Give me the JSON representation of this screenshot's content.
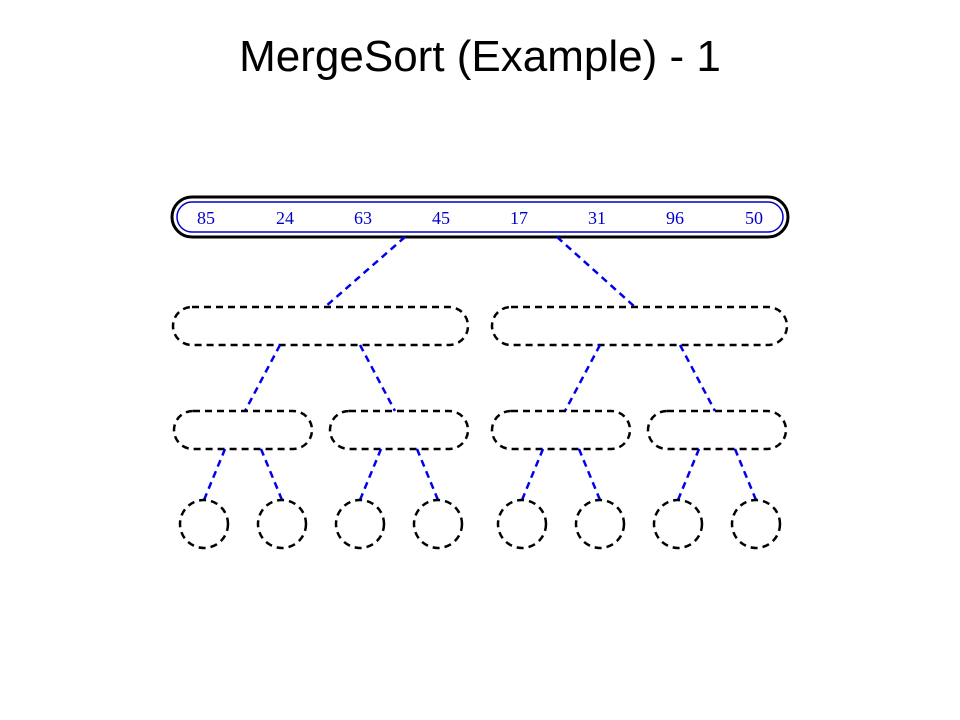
{
  "title": "MergeSort (Example) - 1",
  "values": [
    "85",
    "24",
    "63",
    "45",
    "17",
    "31",
    "96",
    "50"
  ],
  "tree": {
    "levels": 4,
    "leaves": 8,
    "state": "initial-split",
    "populated_levels": [
      0
    ]
  }
}
